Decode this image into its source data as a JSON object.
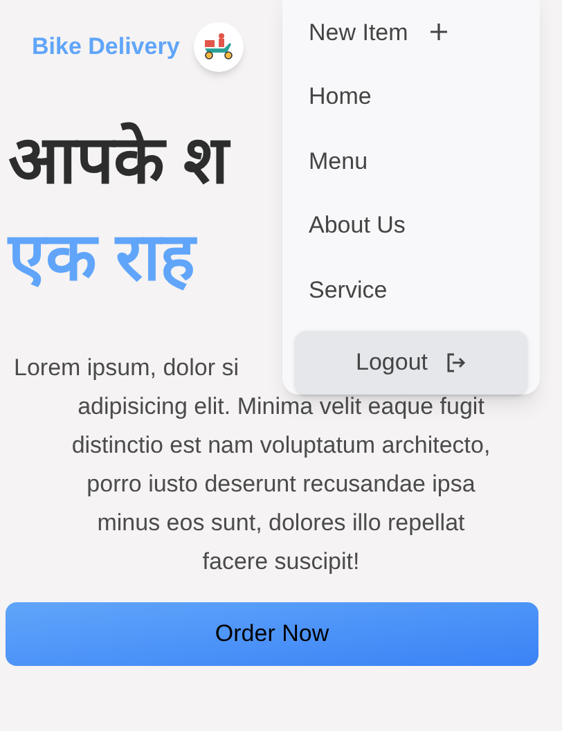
{
  "header": {
    "brand": "Bike Delivery"
  },
  "hero": {
    "headline_lines": [
      {
        "text": "आपके श",
        "kind": "dark"
      },
      {
        "text": "एक राह",
        "kind": "accent"
      }
    ],
    "paragraph_lines": [
      "Lorem ipsum, dolor si",
      "adipisicing elit. Minima velit eaque fugit",
      "distinctio est nam voluptatum architecto,",
      "porro iusto deserunt recusandae ipsa",
      "minus eos sunt, dolores illo repellat",
      "facere suscipit!"
    ],
    "button": "Order Now"
  },
  "menu": {
    "items": [
      {
        "label": "New Item",
        "kind": "add"
      },
      {
        "label": "Home",
        "kind": "link"
      },
      {
        "label": "Menu",
        "kind": "link"
      },
      {
        "label": "About Us",
        "kind": "link"
      },
      {
        "label": "Service",
        "kind": "link"
      }
    ],
    "logout": "Logout"
  }
}
